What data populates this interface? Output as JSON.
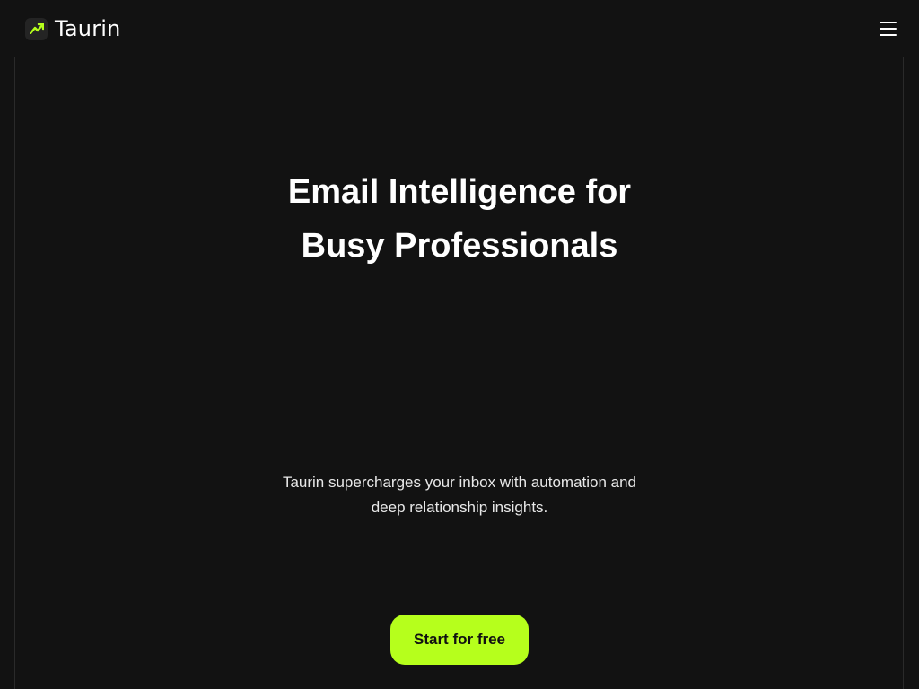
{
  "header": {
    "brand_name": "Taurin",
    "brand_icon": "trend-arrow-icon",
    "menu_icon": "hamburger-menu-icon"
  },
  "hero": {
    "title": "Email Intelligence for Busy Professionals",
    "subtitle": "Taurin supercharges your inbox with automation and deep relationship insights.",
    "cta_label": "Start for free"
  },
  "colors": {
    "background": "#121212",
    "accent": "#b6ff1c",
    "border": "#2a2a2a",
    "text": "#ffffff"
  }
}
